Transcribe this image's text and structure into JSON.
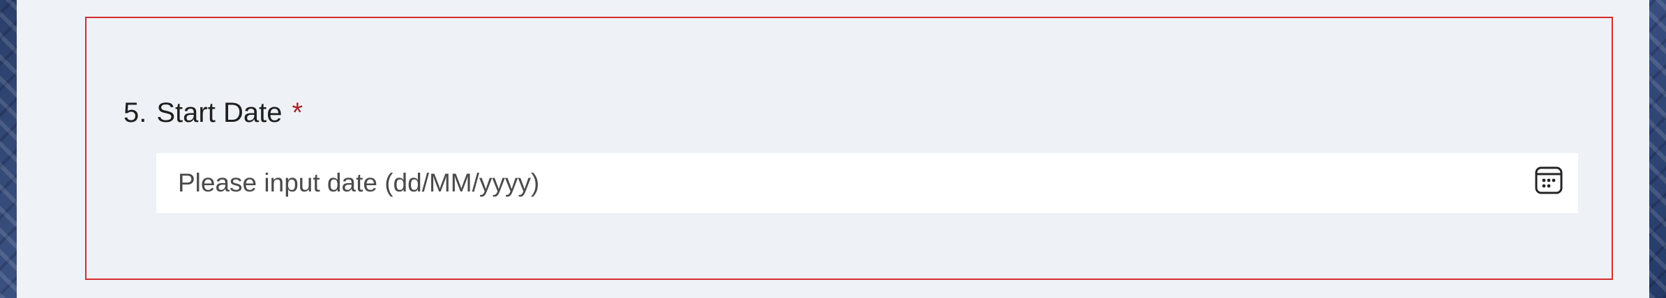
{
  "question": {
    "number": "5.",
    "title": "Start Date",
    "required_mark": "*",
    "date_input": {
      "placeholder": "Please input date (dd/MM/yyyy)",
      "icon": "calendar-icon"
    }
  },
  "colors": {
    "error_border": "#d62c2c",
    "required": "#a4262c",
    "panel_bg": "#eff2f6"
  }
}
